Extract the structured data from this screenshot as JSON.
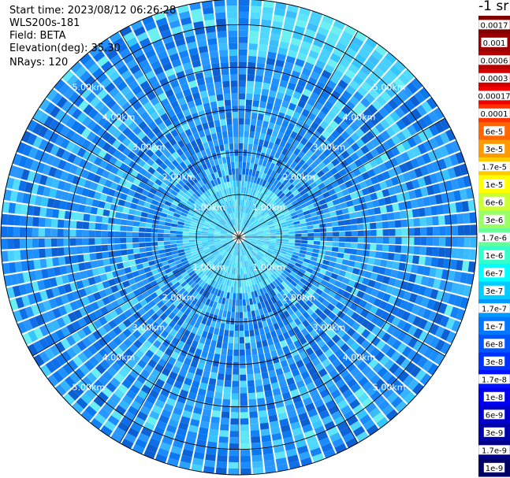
{
  "info": {
    "start_time": "Start time: 2023/08/12 06:26:28",
    "instrument": "WLS200s-181",
    "field": "Field: BETA",
    "elevation": "Elevation(deg): 35.30",
    "nrays": "NRays: 120"
  },
  "chart_data": {
    "type": "heatmap",
    "projection": "polar-ppi",
    "rays": 120,
    "range_max_km": 5.6,
    "range_rings_km": [
      1.0,
      2.0,
      3.0,
      4.0,
      5.0
    ],
    "range_ring_labels": [
      "1.00km",
      "2.00km",
      "3.00km",
      "4.00km",
      "5.00km"
    ],
    "spokes_deg": [
      0,
      30,
      60,
      90,
      120,
      150,
      180,
      210,
      240,
      270,
      300,
      330
    ],
    "colorbar": {
      "unit_label": "-1 sr",
      "labels_top_to_bottom": [
        "0.0017",
        "0.001",
        "0.0006",
        "0.0003",
        "0.00017",
        "0.0001",
        "6e-5",
        "3e-5",
        "1.7e-5",
        "1e-5",
        "6e-6",
        "3e-6",
        "1.7e-6",
        "1e-6",
        "6e-7",
        "3e-7",
        "1.7e-7",
        "1e-7",
        "6e-8",
        "3e-8",
        "1.7e-8",
        "1e-8",
        "6e-9",
        "3e-9",
        "1.7e-9",
        "1e-9"
      ],
      "colors_top_to_bottom": [
        "#800000",
        "#9b0000",
        "#b50000",
        "#d40000",
        "#f00000",
        "#ff3300",
        "#ff6600",
        "#ff9900",
        "#ffcc00",
        "#ffff00",
        "#ccff33",
        "#99ff66",
        "#66ff99",
        "#33ffcc",
        "#00ffff",
        "#00ccff",
        "#0099ff",
        "#0077ff",
        "#0055ff",
        "#0033ff",
        "#0011ff",
        "#0000ee",
        "#0000cc",
        "#0000aa",
        "#000088",
        "#000066"
      ]
    },
    "field_description_values": {
      "dominant_range": [
        "3e-8",
        "1e-7"
      ]
    }
  }
}
